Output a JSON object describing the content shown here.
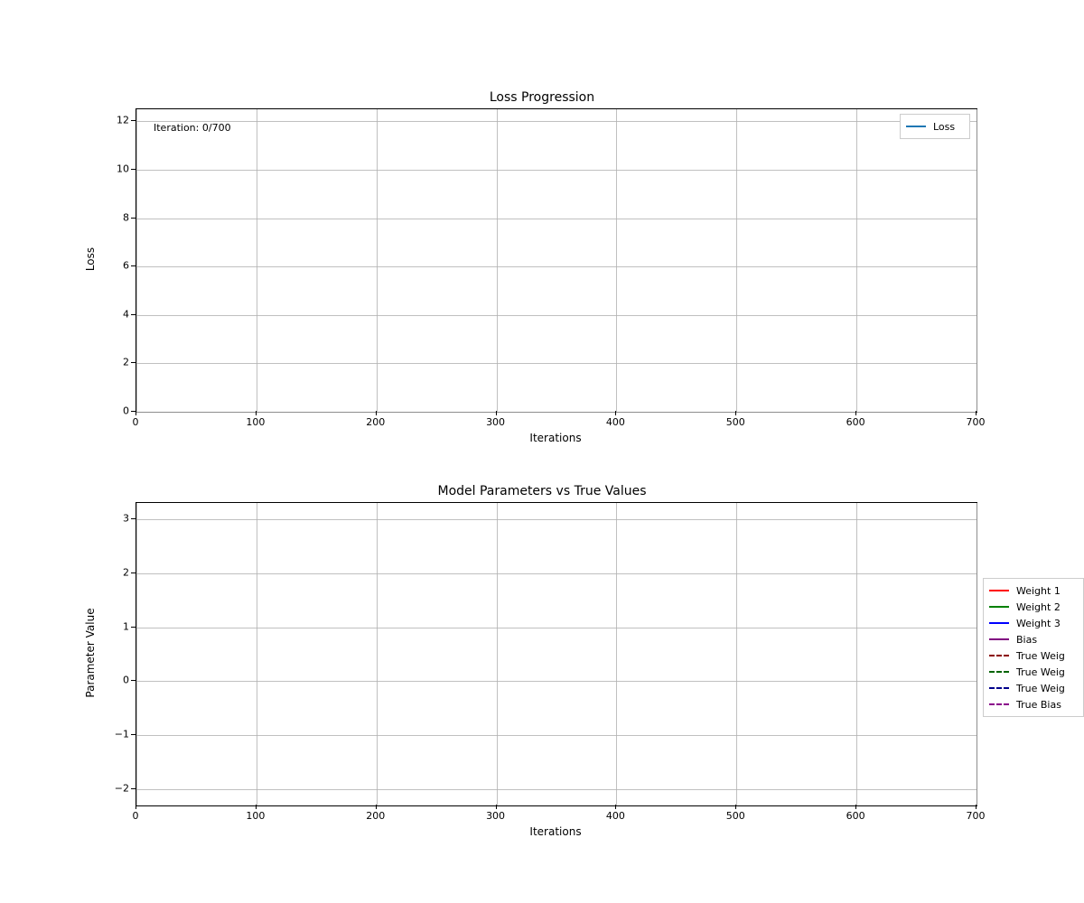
{
  "chart_data": [
    {
      "type": "line",
      "title": "Loss Progression",
      "xlabel": "Iterations",
      "ylabel": "Loss",
      "xlim": [
        0,
        700
      ],
      "ylim": [
        0,
        12.5
      ],
      "xticks": [
        0,
        100,
        200,
        300,
        400,
        500,
        600,
        700
      ],
      "yticks": [
        0,
        2,
        4,
        6,
        8,
        10,
        12
      ],
      "series": [
        {
          "name": "Loss",
          "color": "#1f77b4",
          "style": "solid",
          "values": []
        }
      ],
      "annotation": "Iteration: 0/700",
      "legend_position": "upper right"
    },
    {
      "type": "line",
      "title": "Model Parameters vs True Values",
      "xlabel": "Iterations",
      "ylabel": "Parameter Value",
      "xlim": [
        0,
        700
      ],
      "ylim": [
        -2.3,
        3.3
      ],
      "xticks": [
        0,
        100,
        200,
        300,
        400,
        500,
        600,
        700
      ],
      "yticks": [
        -2,
        -1,
        0,
        1,
        2,
        3
      ],
      "series": [
        {
          "name": "Weight 1",
          "color": "#ff0000",
          "style": "solid",
          "values": []
        },
        {
          "name": "Weight 2",
          "color": "#008000",
          "style": "solid",
          "values": []
        },
        {
          "name": "Weight 3",
          "color": "#0000ff",
          "style": "solid",
          "values": []
        },
        {
          "name": "Bias",
          "color": "#800080",
          "style": "solid",
          "values": []
        },
        {
          "name": "True Weig",
          "color": "#8b0000",
          "style": "dashed",
          "values": []
        },
        {
          "name": "True Weig",
          "color": "#006400",
          "style": "dashed",
          "values": []
        },
        {
          "name": "True Weig",
          "color": "#00008b",
          "style": "dashed",
          "values": []
        },
        {
          "name": "True Bias",
          "color": "#8b008b",
          "style": "dashed",
          "values": []
        }
      ],
      "legend_position": "right-outside"
    }
  ]
}
